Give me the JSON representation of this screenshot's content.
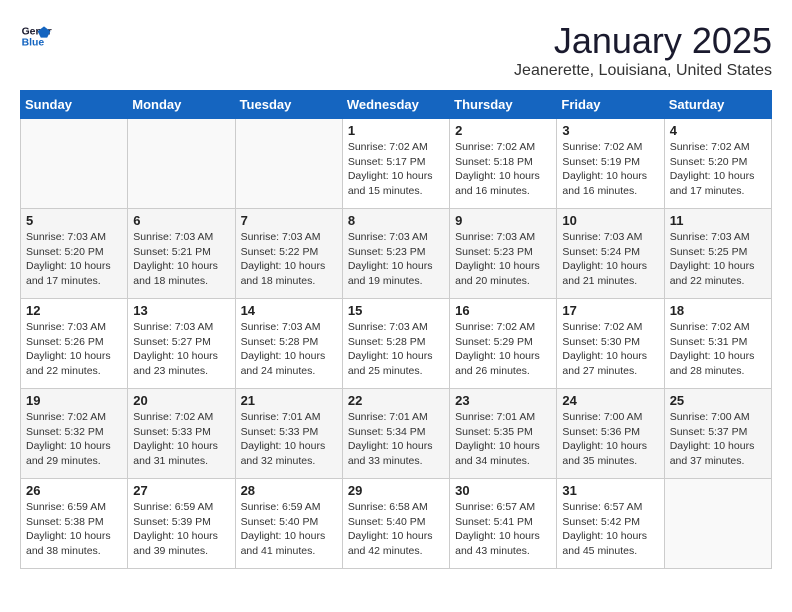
{
  "logo": {
    "line1": "General",
    "line2": "Blue"
  },
  "title": "January 2025",
  "subtitle": "Jeanerette, Louisiana, United States",
  "days_of_week": [
    "Sunday",
    "Monday",
    "Tuesday",
    "Wednesday",
    "Thursday",
    "Friday",
    "Saturday"
  ],
  "weeks": [
    [
      {
        "day": "",
        "info": ""
      },
      {
        "day": "",
        "info": ""
      },
      {
        "day": "",
        "info": ""
      },
      {
        "day": "1",
        "info": "Sunrise: 7:02 AM\nSunset: 5:17 PM\nDaylight: 10 hours\nand 15 minutes."
      },
      {
        "day": "2",
        "info": "Sunrise: 7:02 AM\nSunset: 5:18 PM\nDaylight: 10 hours\nand 16 minutes."
      },
      {
        "day": "3",
        "info": "Sunrise: 7:02 AM\nSunset: 5:19 PM\nDaylight: 10 hours\nand 16 minutes."
      },
      {
        "day": "4",
        "info": "Sunrise: 7:02 AM\nSunset: 5:20 PM\nDaylight: 10 hours\nand 17 minutes."
      }
    ],
    [
      {
        "day": "5",
        "info": "Sunrise: 7:03 AM\nSunset: 5:20 PM\nDaylight: 10 hours\nand 17 minutes."
      },
      {
        "day": "6",
        "info": "Sunrise: 7:03 AM\nSunset: 5:21 PM\nDaylight: 10 hours\nand 18 minutes."
      },
      {
        "day": "7",
        "info": "Sunrise: 7:03 AM\nSunset: 5:22 PM\nDaylight: 10 hours\nand 18 minutes."
      },
      {
        "day": "8",
        "info": "Sunrise: 7:03 AM\nSunset: 5:23 PM\nDaylight: 10 hours\nand 19 minutes."
      },
      {
        "day": "9",
        "info": "Sunrise: 7:03 AM\nSunset: 5:23 PM\nDaylight: 10 hours\nand 20 minutes."
      },
      {
        "day": "10",
        "info": "Sunrise: 7:03 AM\nSunset: 5:24 PM\nDaylight: 10 hours\nand 21 minutes."
      },
      {
        "day": "11",
        "info": "Sunrise: 7:03 AM\nSunset: 5:25 PM\nDaylight: 10 hours\nand 22 minutes."
      }
    ],
    [
      {
        "day": "12",
        "info": "Sunrise: 7:03 AM\nSunset: 5:26 PM\nDaylight: 10 hours\nand 22 minutes."
      },
      {
        "day": "13",
        "info": "Sunrise: 7:03 AM\nSunset: 5:27 PM\nDaylight: 10 hours\nand 23 minutes."
      },
      {
        "day": "14",
        "info": "Sunrise: 7:03 AM\nSunset: 5:28 PM\nDaylight: 10 hours\nand 24 minutes."
      },
      {
        "day": "15",
        "info": "Sunrise: 7:03 AM\nSunset: 5:28 PM\nDaylight: 10 hours\nand 25 minutes."
      },
      {
        "day": "16",
        "info": "Sunrise: 7:02 AM\nSunset: 5:29 PM\nDaylight: 10 hours\nand 26 minutes."
      },
      {
        "day": "17",
        "info": "Sunrise: 7:02 AM\nSunset: 5:30 PM\nDaylight: 10 hours\nand 27 minutes."
      },
      {
        "day": "18",
        "info": "Sunrise: 7:02 AM\nSunset: 5:31 PM\nDaylight: 10 hours\nand 28 minutes."
      }
    ],
    [
      {
        "day": "19",
        "info": "Sunrise: 7:02 AM\nSunset: 5:32 PM\nDaylight: 10 hours\nand 29 minutes."
      },
      {
        "day": "20",
        "info": "Sunrise: 7:02 AM\nSunset: 5:33 PM\nDaylight: 10 hours\nand 31 minutes."
      },
      {
        "day": "21",
        "info": "Sunrise: 7:01 AM\nSunset: 5:33 PM\nDaylight: 10 hours\nand 32 minutes."
      },
      {
        "day": "22",
        "info": "Sunrise: 7:01 AM\nSunset: 5:34 PM\nDaylight: 10 hours\nand 33 minutes."
      },
      {
        "day": "23",
        "info": "Sunrise: 7:01 AM\nSunset: 5:35 PM\nDaylight: 10 hours\nand 34 minutes."
      },
      {
        "day": "24",
        "info": "Sunrise: 7:00 AM\nSunset: 5:36 PM\nDaylight: 10 hours\nand 35 minutes."
      },
      {
        "day": "25",
        "info": "Sunrise: 7:00 AM\nSunset: 5:37 PM\nDaylight: 10 hours\nand 37 minutes."
      }
    ],
    [
      {
        "day": "26",
        "info": "Sunrise: 6:59 AM\nSunset: 5:38 PM\nDaylight: 10 hours\nand 38 minutes."
      },
      {
        "day": "27",
        "info": "Sunrise: 6:59 AM\nSunset: 5:39 PM\nDaylight: 10 hours\nand 39 minutes."
      },
      {
        "day": "28",
        "info": "Sunrise: 6:59 AM\nSunset: 5:40 PM\nDaylight: 10 hours\nand 41 minutes."
      },
      {
        "day": "29",
        "info": "Sunrise: 6:58 AM\nSunset: 5:40 PM\nDaylight: 10 hours\nand 42 minutes."
      },
      {
        "day": "30",
        "info": "Sunrise: 6:57 AM\nSunset: 5:41 PM\nDaylight: 10 hours\nand 43 minutes."
      },
      {
        "day": "31",
        "info": "Sunrise: 6:57 AM\nSunset: 5:42 PM\nDaylight: 10 hours\nand 45 minutes."
      },
      {
        "day": "",
        "info": ""
      }
    ]
  ]
}
